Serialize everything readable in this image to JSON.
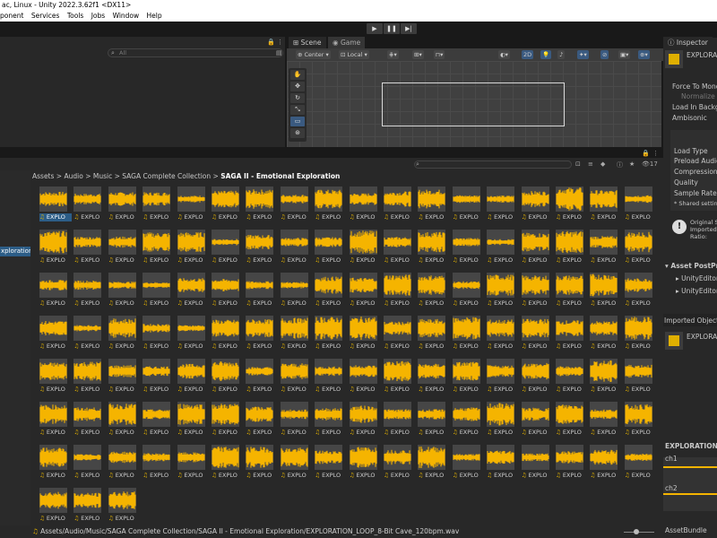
{
  "window": {
    "title": "ac, Linux - Unity 2022.3.62f1 <DX11>"
  },
  "menu": [
    "ponent",
    "Services",
    "Tools",
    "Jobs",
    "Window",
    "Help"
  ],
  "play_controls": [
    "▶",
    "❚❚",
    "▶|"
  ],
  "hierarchy": {
    "search_placeholder": "All"
  },
  "tabs": {
    "scene": "Scene",
    "game": "Game",
    "inspector": "Inspector"
  },
  "scene_toolbar": {
    "pivot": "Center",
    "space": "Local",
    "mode_2d": "2D"
  },
  "project": {
    "breadcrumb": [
      "Assets",
      "Audio",
      "Music",
      "SAGA Complete Collection",
      "SAGA II - Emotional Exploration"
    ],
    "left_folder": "xploration",
    "item_label": "EXPLO",
    "count_badge": "17",
    "status_path": "Assets/Audio/Music/SAGA Complete Collection/SAGA II - Emotional Exploration/EXPLORATION_LOOP_8-Bit Cave_120bpm.wav"
  },
  "inspector": {
    "asset_name": "EXPLORA",
    "force_mono": "Force To Mono",
    "normalize": "Normalize",
    "load_bg": "Load In Backgr",
    "ambisonic": "Ambisonic",
    "load_type": "Load Type",
    "preload": "Preload Audio",
    "compression": "Compression F",
    "quality": "Quality",
    "sample_rate": "Sample Rate S",
    "shared": "* Shared setting",
    "original_size": "Original Si",
    "imported_size": "Imported S",
    "ratio": "Ratio:",
    "postproc": "Asset PostPro",
    "unity_editor_1": "UnityEditor",
    "unity_editor_2": "UnityEditor",
    "imported_object": "Imported Object",
    "imported_name": "EXPLORA",
    "waveform_title": "EXPLORATION_L",
    "ch1": "ch1",
    "ch2": "ch2",
    "asset_bundle": "AssetBundle"
  },
  "colors": {
    "accent": "#2c5d87",
    "waveform": "#f5b400",
    "background": "#282828"
  }
}
